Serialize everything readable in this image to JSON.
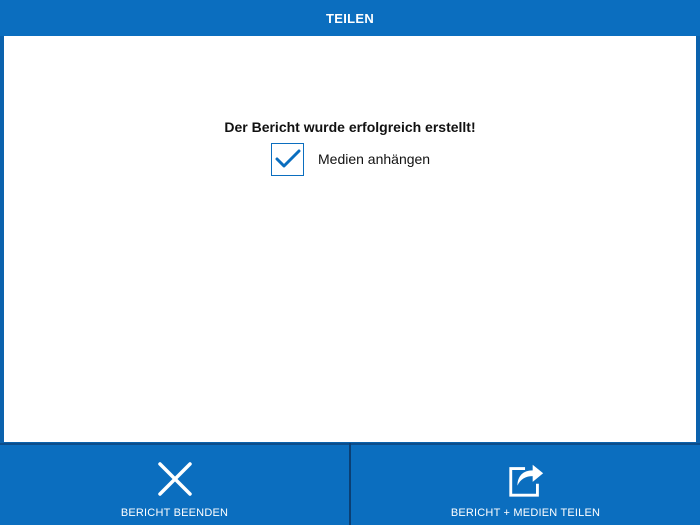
{
  "header": {
    "title": "TEILEN"
  },
  "main": {
    "message": "Der Bericht wurde erfolgreich erstellt!",
    "attach_media": {
      "label": "Medien anhängen",
      "checked": true
    }
  },
  "footer": {
    "buttons": [
      {
        "label": "BERICHT BEENDEN",
        "icon": "close-icon"
      },
      {
        "label": "BERICHT + MEDIEN TEILEN",
        "icon": "share-icon"
      }
    ]
  },
  "colors": {
    "accent": "#0b6ebf",
    "background": "#ffffff",
    "text": "#111111"
  }
}
